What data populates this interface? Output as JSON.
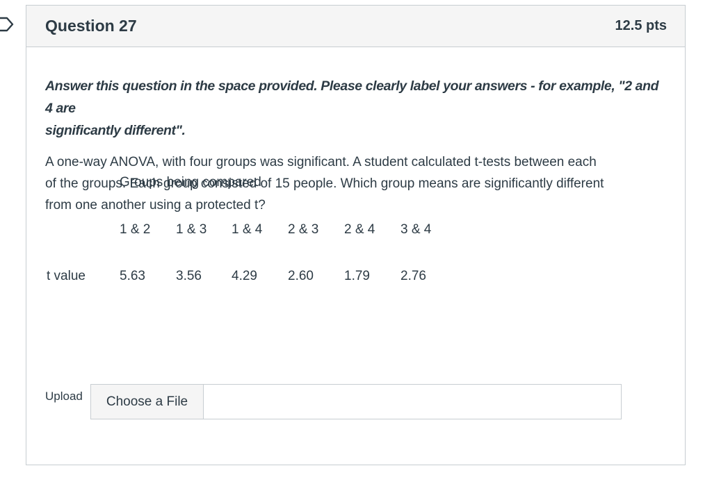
{
  "question": {
    "title": "Question 27",
    "points": "12.5 pts",
    "instructions_line1": "Answer this question in the space provided. Please clearly label your answers - for example, \"2 and 4 are",
    "instructions_line2": "significantly different\".",
    "text_line1": "A one-way ANOVA, with four groups was significant.  A student calculated t-tests between each",
    "text_line2": "of the  groups.  Each group consisted of 15 people.  Which group means are significantly different",
    "text_line3": "from one another using a protected t?"
  },
  "table": {
    "caption": "Groups being compared",
    "row_label": "t value",
    "pairs": [
      "1 & 2",
      "1 & 3",
      "1 & 4",
      "2 & 3",
      "2 & 4",
      "3 & 4"
    ],
    "t_values": [
      "5.63",
      "3.56",
      "4.29",
      "2.60",
      "1.79",
      "2.76"
    ]
  },
  "upload": {
    "label": "Upload",
    "button_label": "Choose a File",
    "file_name": ""
  },
  "icons": {
    "flag": "bookmark-flag-icon"
  },
  "colors": {
    "text": "#2d3b45",
    "border": "#c7cdd1",
    "header_bg": "#f5f5f5"
  }
}
